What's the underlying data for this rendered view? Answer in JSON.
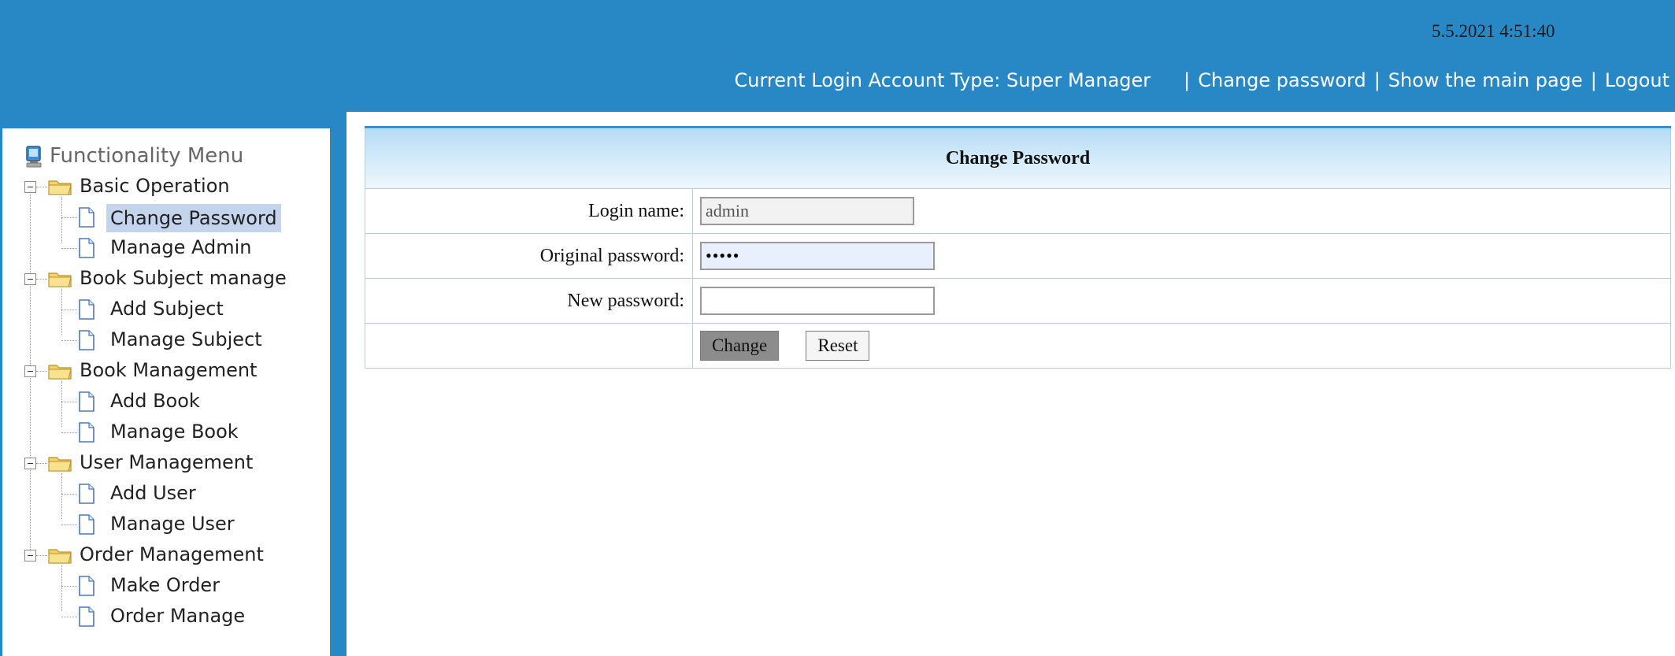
{
  "header": {
    "datetime": "5.5.2021 4:51:40",
    "account_type": "Current Login Account Type: Super Manager",
    "links": [
      "Change password",
      "Show the main page",
      "Logout"
    ]
  },
  "sidebar": {
    "title": "Functionality Menu",
    "groups": [
      {
        "label": "Basic Operation",
        "items": [
          "Change Password",
          "Manage Admin"
        ]
      },
      {
        "label": "Book Subject manage",
        "items": [
          "Add Subject",
          "Manage Subject"
        ]
      },
      {
        "label": "Book Management",
        "items": [
          "Add Book",
          "Manage Book"
        ]
      },
      {
        "label": "User Management",
        "items": [
          "Add User",
          "Manage User"
        ]
      },
      {
        "label": "Order Management",
        "items": [
          "Make Order",
          "Order Manage"
        ]
      }
    ],
    "selected": "Change Password"
  },
  "form": {
    "title": "Change Password",
    "login_label": "Login name:",
    "login_value": "admin",
    "original_label": "Original password:",
    "original_value": "•••••",
    "new_label": "New password:",
    "new_value": "",
    "change_button": "Change",
    "reset_button": "Reset"
  },
  "colors": {
    "header_bg": "#2887c5",
    "selected_bg": "#c4d4ec",
    "table_border": "#b6cde8"
  }
}
